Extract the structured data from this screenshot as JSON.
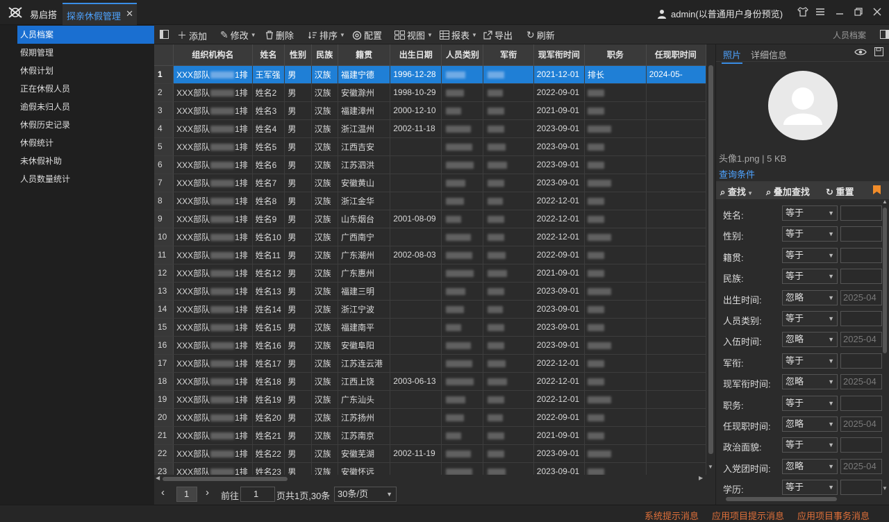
{
  "app": {
    "name": "易启搭",
    "active_tab": "探亲休假管理",
    "tab_close": "✕",
    "user": "admin(以普通用户身份预览)"
  },
  "sidebar": {
    "items": [
      {
        "label": "人员档案",
        "active": true
      },
      {
        "label": "假期管理"
      },
      {
        "label": "休假计划"
      },
      {
        "label": "正在休假人员"
      },
      {
        "label": "逾假未归人员"
      },
      {
        "label": "休假历史记录"
      },
      {
        "label": "休假统计"
      },
      {
        "label": "未休假补助"
      },
      {
        "label": "人员数量统计"
      }
    ]
  },
  "toolbar": {
    "add": "添加",
    "edit": "修改",
    "delete": "删除",
    "sort": "排序",
    "config": "配置",
    "view": "视图",
    "report": "报表",
    "export": "导出",
    "refresh": "刷新",
    "panel_title": "人员档案"
  },
  "table": {
    "columns": [
      "组织机构名",
      "姓名",
      "性别",
      "民族",
      "籍贯",
      "出生日期",
      "人员类别",
      "军衔",
      "现军衔时间",
      "职务",
      "任现职时间"
    ],
    "rows": [
      {
        "n": "1",
        "org": "XXX部队",
        "org2": "1排",
        "name": "王军强",
        "sex": "男",
        "eth": "汉族",
        "place": "福建宁德",
        "birth": "1996-12-28",
        "rank_date": "2021-12-01",
        "duty": "排长",
        "duty_date": "2024-05-"
      },
      {
        "n": "2",
        "org": "XXX部队",
        "org2": "1排",
        "name": "姓名2",
        "sex": "男",
        "eth": "汉族",
        "place": "安徽滁州",
        "birth": "1998-10-29",
        "rank_date": "2022-09-01",
        "duty": "",
        "duty_date": ""
      },
      {
        "n": "3",
        "org": "XXX部队",
        "org2": "1排",
        "name": "姓名3",
        "sex": "男",
        "eth": "汉族",
        "place": "福建漳州",
        "birth": "2000-12-10",
        "rank_date": "2021-09-01",
        "duty": "",
        "duty_date": ""
      },
      {
        "n": "4",
        "org": "XXX部队",
        "org2": "1排",
        "name": "姓名4",
        "sex": "男",
        "eth": "汉族",
        "place": "浙江温州",
        "birth": "2002-11-18",
        "rank_date": "2023-09-01",
        "duty": "",
        "duty_date": ""
      },
      {
        "n": "5",
        "org": "XXX部队",
        "org2": "1排",
        "name": "姓名5",
        "sex": "男",
        "eth": "汉族",
        "place": "江西吉安",
        "birth": "",
        "rank_date": "2023-09-01",
        "duty": "",
        "duty_date": ""
      },
      {
        "n": "6",
        "org": "XXX部队",
        "org2": "1排",
        "name": "姓名6",
        "sex": "男",
        "eth": "汉族",
        "place": "江苏泗洪",
        "birth": "",
        "rank_date": "2023-09-01",
        "duty": "",
        "duty_date": ""
      },
      {
        "n": "7",
        "org": "XXX部队",
        "org2": "1排",
        "name": "姓名7",
        "sex": "男",
        "eth": "汉族",
        "place": "安徽黄山",
        "birth": "",
        "rank_date": "2023-09-01",
        "duty": "",
        "duty_date": ""
      },
      {
        "n": "8",
        "org": "XXX部队",
        "org2": "1排",
        "name": "姓名8",
        "sex": "男",
        "eth": "汉族",
        "place": "浙江金华",
        "birth": "",
        "rank_date": "2022-12-01",
        "duty": "",
        "duty_date": ""
      },
      {
        "n": "9",
        "org": "XXX部队",
        "org2": "1排",
        "name": "姓名9",
        "sex": "男",
        "eth": "汉族",
        "place": "山东烟台",
        "birth": "2001-08-09",
        "rank_date": "2022-12-01",
        "duty": "",
        "duty_date": ""
      },
      {
        "n": "10",
        "org": "XXX部队",
        "org2": "1排",
        "name": "姓名10",
        "sex": "男",
        "eth": "汉族",
        "place": "广西南宁",
        "birth": "",
        "rank_date": "2022-12-01",
        "duty": "",
        "duty_date": ""
      },
      {
        "n": "11",
        "org": "XXX部队",
        "org2": "1排",
        "name": "姓名11",
        "sex": "男",
        "eth": "汉族",
        "place": "广东潮州",
        "birth": "2002-08-03",
        "rank_date": "2022-09-01",
        "duty": "",
        "duty_date": ""
      },
      {
        "n": "12",
        "org": "XXX部队",
        "org2": "1排",
        "name": "姓名12",
        "sex": "男",
        "eth": "汉族",
        "place": "广东惠州",
        "birth": "",
        "rank_date": "2021-09-01",
        "duty": "",
        "duty_date": ""
      },
      {
        "n": "13",
        "org": "XXX部队",
        "org2": "1排",
        "name": "姓名13",
        "sex": "男",
        "eth": "汉族",
        "place": "福建三明",
        "birth": "",
        "rank_date": "2023-09-01",
        "duty": "",
        "duty_date": ""
      },
      {
        "n": "14",
        "org": "XXX部队",
        "org2": "1排",
        "name": "姓名14",
        "sex": "男",
        "eth": "汉族",
        "place": "浙江宁波",
        "birth": "",
        "rank_date": "2023-09-01",
        "duty": "",
        "duty_date": ""
      },
      {
        "n": "15",
        "org": "XXX部队",
        "org2": "1排",
        "name": "姓名15",
        "sex": "男",
        "eth": "汉族",
        "place": "福建南平",
        "birth": "",
        "rank_date": "2023-09-01",
        "duty": "",
        "duty_date": ""
      },
      {
        "n": "16",
        "org": "XXX部队",
        "org2": "1排",
        "name": "姓名16",
        "sex": "男",
        "eth": "汉族",
        "place": "安徽阜阳",
        "birth": "",
        "rank_date": "2023-09-01",
        "duty": "",
        "duty_date": ""
      },
      {
        "n": "17",
        "org": "XXX部队",
        "org2": "1排",
        "name": "姓名17",
        "sex": "男",
        "eth": "汉族",
        "place": "江苏连云港",
        "birth": "",
        "rank_date": "2022-12-01",
        "duty": "",
        "duty_date": ""
      },
      {
        "n": "18",
        "org": "XXX部队",
        "org2": "1排",
        "name": "姓名18",
        "sex": "男",
        "eth": "汉族",
        "place": "江西上饶",
        "birth": "2003-06-13",
        "rank_date": "2022-12-01",
        "duty": "",
        "duty_date": ""
      },
      {
        "n": "19",
        "org": "XXX部队",
        "org2": "1排",
        "name": "姓名19",
        "sex": "男",
        "eth": "汉族",
        "place": "广东汕头",
        "birth": "",
        "rank_date": "2022-12-01",
        "duty": "",
        "duty_date": ""
      },
      {
        "n": "20",
        "org": "XXX部队",
        "org2": "1排",
        "name": "姓名20",
        "sex": "男",
        "eth": "汉族",
        "place": "江苏扬州",
        "birth": "",
        "rank_date": "2022-09-01",
        "duty": "",
        "duty_date": ""
      },
      {
        "n": "21",
        "org": "XXX部队",
        "org2": "1排",
        "name": "姓名21",
        "sex": "男",
        "eth": "汉族",
        "place": "江苏南京",
        "birth": "",
        "rank_date": "2021-09-01",
        "duty": "",
        "duty_date": ""
      },
      {
        "n": "22",
        "org": "XXX部队",
        "org2": "1排",
        "name": "姓名22",
        "sex": "男",
        "eth": "汉族",
        "place": "安徽芜湖",
        "birth": "2002-11-19",
        "rank_date": "2023-09-01",
        "duty": "",
        "duty_date": ""
      },
      {
        "n": "23",
        "org": "XXX部队",
        "org2": "1排",
        "name": "姓名23",
        "sex": "男",
        "eth": "汉族",
        "place": "安徽怀远",
        "birth": "",
        "rank_date": "2023-09-01",
        "duty": "",
        "duty_date": ""
      }
    ]
  },
  "pager": {
    "current": "1",
    "goto_label": "前往",
    "goto_value": "1",
    "summary": "页共1页,30条",
    "page_size": "30条/页"
  },
  "right": {
    "tab_photo": "照片",
    "tab_detail": "详细信息",
    "file_meta": "头像1.png | 5 KB",
    "query_title": "查询条件",
    "query_find": "查找",
    "query_stack": "叠加查找",
    "query_reset": "重置",
    "filters": [
      {
        "label": "姓名:",
        "op": "等于",
        "value": ""
      },
      {
        "label": "性别:",
        "op": "等于",
        "value": ""
      },
      {
        "label": "籍贯:",
        "op": "等于",
        "value": ""
      },
      {
        "label": "民族:",
        "op": "等于",
        "value": ""
      },
      {
        "label": "出生时间:",
        "op": "忽略",
        "value": "2025-04"
      },
      {
        "label": "人员类别:",
        "op": "等于",
        "value": ""
      },
      {
        "label": "入伍时间:",
        "op": "忽略",
        "value": "2025-04"
      },
      {
        "label": "军衔:",
        "op": "等于",
        "value": ""
      },
      {
        "label": "现军衔时间:",
        "op": "忽略",
        "value": "2025-04"
      },
      {
        "label": "职务:",
        "op": "等于",
        "value": ""
      },
      {
        "label": "任现职时间:",
        "op": "忽略",
        "value": "2025-04"
      },
      {
        "label": "政治面貌:",
        "op": "等于",
        "value": ""
      },
      {
        "label": "入党团时间:",
        "op": "忽略",
        "value": "2025-04"
      },
      {
        "label": "学历:",
        "op": "等于",
        "value": ""
      }
    ]
  },
  "status": {
    "sys": "系统提示消息",
    "proj": "应用项目提示消息",
    "task": "应用项目事务消息"
  },
  "colors": {
    "accent": "#1f7fd6",
    "status_text": "#e0703a",
    "bg": "#2b2b2b"
  }
}
